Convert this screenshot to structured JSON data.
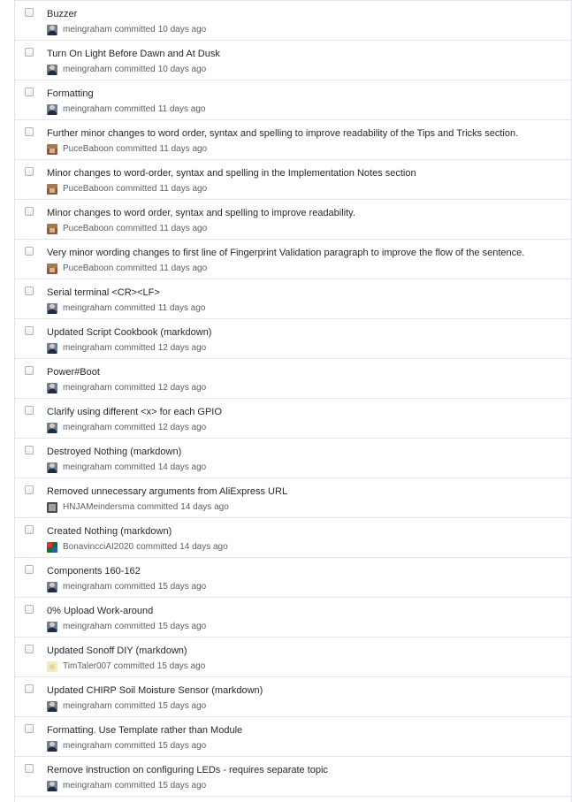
{
  "committed_word": "committed",
  "commits": [
    {
      "title": "Buzzer",
      "author": "meingraham",
      "avatar": "av-person",
      "when": "10 days ago"
    },
    {
      "title": "Turn On Light Before Dawn and At Dusk",
      "author": "meingraham",
      "avatar": "av-person",
      "when": "10 days ago"
    },
    {
      "title": "Formatting",
      "author": "meingraham",
      "avatar": "av-person",
      "when": "11 days ago"
    },
    {
      "title": "Further minor changes to word order, syntax and spelling to improve readability of the Tips and Tricks section.",
      "author": "PuceBaboon",
      "avatar": "av-puce",
      "when": "11 days ago"
    },
    {
      "title": "Minor changes to word-order, syntax and spelling in the Implementation Notes section",
      "author": "PuceBaboon",
      "avatar": "av-puce",
      "when": "11 days ago"
    },
    {
      "title": "Minor changes to word order, syntax and spelling to improve readability.",
      "author": "PuceBaboon",
      "avatar": "av-puce",
      "when": "11 days ago"
    },
    {
      "title": "Very minor wording changes to first line of Fingerprint Validation paragraph to improve the flow of the sentence.",
      "author": "PuceBaboon",
      "avatar": "av-puce",
      "when": "11 days ago"
    },
    {
      "title": "Serial terminal <CR><LF>",
      "author": "meingraham",
      "avatar": "av-person",
      "when": "11 days ago"
    },
    {
      "title": "Updated Script Cookbook (markdown)",
      "author": "meingraham",
      "avatar": "av-person",
      "when": "12 days ago"
    },
    {
      "title": "Power#Boot",
      "author": "meingraham",
      "avatar": "av-person",
      "when": "12 days ago"
    },
    {
      "title": "Clarify using different <x> for each GPIO",
      "author": "meingraham",
      "avatar": "av-person",
      "when": "12 days ago"
    },
    {
      "title": "Destroyed Nothing (markdown)",
      "author": "meingraham",
      "avatar": "av-person",
      "when": "14 days ago"
    },
    {
      "title": "Removed unnecessary arguments from AliExpress URL",
      "author": "HNJAMeindersma",
      "avatar": "av-dark",
      "when": "14 days ago"
    },
    {
      "title": "Created Nothing (markdown)",
      "author": "BonavincciAI2020",
      "avatar": "av-rubik",
      "when": "14 days ago"
    },
    {
      "title": "Components 160-162",
      "author": "meingraham",
      "avatar": "av-person",
      "when": "15 days ago"
    },
    {
      "title": "0% Upload Work-around",
      "author": "meingraham",
      "avatar": "av-person",
      "when": "15 days ago"
    },
    {
      "title": "Updated Sonoff DIY (markdown)",
      "author": "TimTaler007",
      "avatar": "av-light",
      "when": "15 days ago"
    },
    {
      "title": "Updated CHIRP Soil Moisture Sensor (markdown)",
      "author": "meingraham",
      "avatar": "av-person",
      "when": "15 days ago"
    },
    {
      "title": "Formatting. Use Template rather than Module",
      "author": "meingraham",
      "avatar": "av-person",
      "when": "15 days ago"
    },
    {
      "title": "Remove instruction on configuring LEDs - requires separate topic",
      "author": "meingraham",
      "avatar": "av-person",
      "when": "15 days ago"
    }
  ]
}
